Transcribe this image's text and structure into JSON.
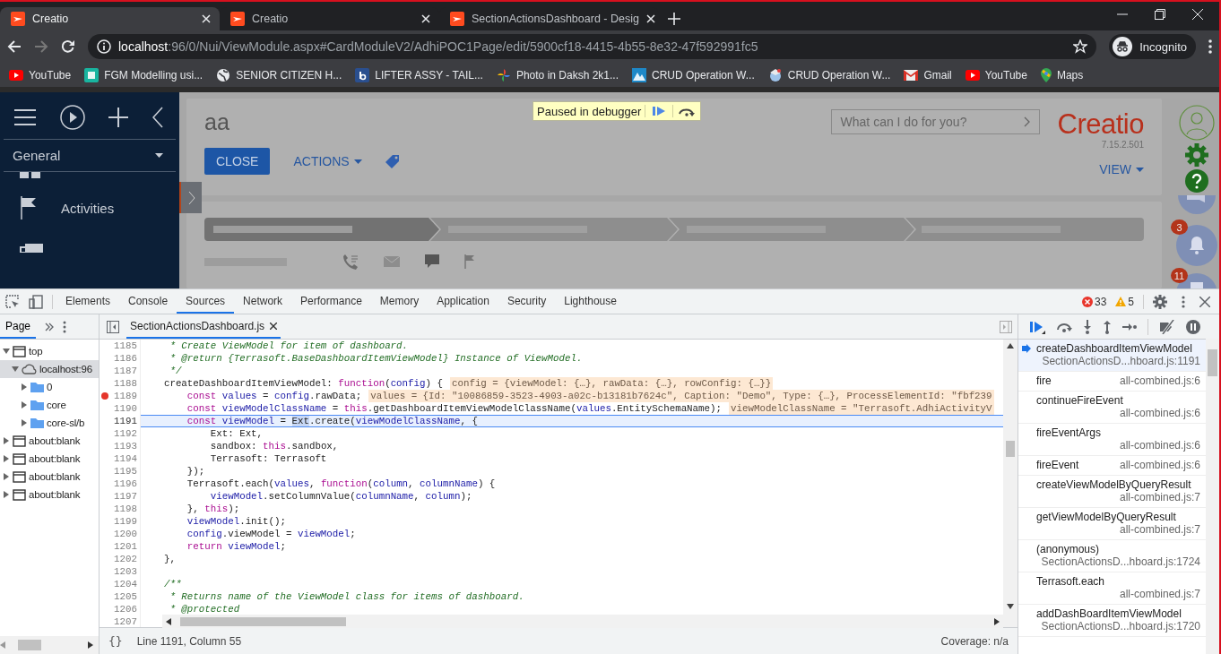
{
  "browser": {
    "tabs": [
      {
        "title": "Creatio",
        "selected": true
      },
      {
        "title": "Creatio",
        "selected": false
      },
      {
        "title": "SectionActionsDashboard - Desig",
        "selected": false
      }
    ],
    "address": {
      "host": "localhost",
      "path": ":96/0/Nui/ViewModule.aspx#CardModuleV2/AdhiPOC1Page/edit/5900cf18-4415-4b55-8e32-47f592991fc5"
    },
    "profile": "Incognito",
    "bookmarks": [
      {
        "kind": "youtube",
        "label": "YouTube"
      },
      {
        "kind": "tile",
        "label": "FGM Modelling usi..."
      },
      {
        "kind": "globe",
        "label": "SENIOR CITIZEN H..."
      },
      {
        "kind": "square",
        "label": "LIFTER ASSY - TAIL..."
      },
      {
        "kind": "pinwheel",
        "label": "Photo in Daksh 2k1..."
      },
      {
        "kind": "mountain",
        "label": "CRUD Operation W..."
      },
      {
        "kind": "app",
        "label": "CRUD Operation W..."
      },
      {
        "kind": "gmail",
        "label": "Gmail"
      },
      {
        "kind": "youtube",
        "label": "YouTube"
      },
      {
        "kind": "maps",
        "label": "Maps"
      }
    ]
  },
  "app": {
    "sidebar": {
      "section": "General",
      "items": [
        {
          "kind": "accounts"
        },
        {
          "kind": "activities",
          "label": "Activities"
        },
        {
          "kind": "feed"
        }
      ]
    },
    "record": {
      "title": "aa",
      "close": "CLOSE",
      "actions": "ACTIONS",
      "view": "VIEW"
    },
    "debugger_banner": "Paused in debugger",
    "search": {
      "placeholder": "What can I do for you?"
    },
    "logo": {
      "name": "Creatio",
      "version": "7.15.2.501"
    },
    "rail": [
      {
        "kind": "chat"
      },
      {
        "kind": "bell",
        "count": "3"
      },
      {
        "kind": "list",
        "count": "11"
      }
    ]
  },
  "devtools": {
    "tabs": [
      {
        "label": "Elements",
        "selected": false
      },
      {
        "label": "Console",
        "selected": false
      },
      {
        "label": "Sources",
        "selected": true
      },
      {
        "label": "Network",
        "selected": false
      },
      {
        "label": "Performance",
        "selected": false
      },
      {
        "label": "Memory",
        "selected": false
      },
      {
        "label": "Application",
        "selected": false
      },
      {
        "label": "Security",
        "selected": false
      },
      {
        "label": "Lighthouse",
        "selected": false
      }
    ],
    "errors": "33",
    "warnings": "5",
    "navigator": {
      "tabs": [
        {
          "label": "Page",
          "selected": true
        }
      ],
      "tree": [
        {
          "label": "top",
          "kind": "frame",
          "expanded": true,
          "selected": false,
          "children": [
            {
              "label": "localhost:96",
              "kind": "cloud",
              "expanded": true,
              "selected": true,
              "children": [
                {
                  "label": "0",
                  "kind": "folder",
                  "expanded": false,
                  "selected": false
                },
                {
                  "label": "core",
                  "kind": "folder",
                  "expanded": false,
                  "selected": false
                },
                {
                  "label": "core-sl/b",
                  "kind": "folder",
                  "expanded": false,
                  "selected": false
                }
              ]
            }
          ]
        },
        {
          "label": "about:blank",
          "kind": "frame",
          "expanded": false,
          "selected": false
        },
        {
          "label": "about:blank",
          "kind": "frame",
          "expanded": false,
          "selected": false
        },
        {
          "label": "about:blank",
          "kind": "frame",
          "expanded": false,
          "selected": false
        },
        {
          "label": "about:blank",
          "kind": "frame",
          "expanded": false,
          "selected": false
        }
      ]
    },
    "editor": {
      "file": "SectionActionsDashboard.js",
      "lines": [
        {
          "n": "1185",
          "breakpoint": false,
          "current": false,
          "tokens": [
            {
              "kind": "comment",
              "text": "     * Create ViewModel for item of dashboard."
            }
          ]
        },
        {
          "n": "1186",
          "breakpoint": false,
          "current": false,
          "tokens": [
            {
              "kind": "comment",
              "text": "     * @return {Terrasoft.BaseDashboardItemViewModel} Instance of ViewModel."
            }
          ]
        },
        {
          "n": "1187",
          "breakpoint": false,
          "current": false,
          "tokens": [
            {
              "kind": "comment",
              "text": "     */"
            }
          ]
        },
        {
          "n": "1188",
          "breakpoint": false,
          "current": false,
          "tokens": [
            {
              "kind": "plain",
              "text": "    createDashboardItemViewModel: "
            },
            {
              "kind": "keyword",
              "text": "function"
            },
            {
              "kind": "plain",
              "text": "("
            },
            {
              "kind": "name",
              "text": "config"
            },
            {
              "kind": "plain",
              "text": ") {"
            }
          ],
          "inline": "config = {viewModel: {…}, rawData: {…}, rowConfig: {…}}"
        },
        {
          "n": "1189",
          "breakpoint": true,
          "current": false,
          "tokens": [
            {
              "kind": "keyword",
              "text": "        const "
            },
            {
              "kind": "name",
              "text": "values"
            },
            {
              "kind": "plain",
              "text": " = "
            },
            {
              "kind": "name",
              "text": "config"
            },
            {
              "kind": "plain",
              "text": ".rawData;"
            }
          ],
          "inline": "values = {Id: \"10086859-3523-4903-a02c-b13181b7624c\", Caption: \"Demo\", Type: {…}, ProcessElementId: \"fbf239"
        },
        {
          "n": "1190",
          "breakpoint": false,
          "current": false,
          "tokens": [
            {
              "kind": "keyword",
              "text": "        const "
            },
            {
              "kind": "name",
              "text": "viewModelClassName"
            },
            {
              "kind": "plain",
              "text": " = "
            },
            {
              "kind": "keyword",
              "text": "this"
            },
            {
              "kind": "plain",
              "text": ".getDashboardItemViewModelClassName("
            },
            {
              "kind": "name",
              "text": "values"
            },
            {
              "kind": "plain",
              "text": ".EntitySchemaName);"
            }
          ],
          "inline": "viewModelClassName = \"Terrasoft.AdhiActivityV"
        },
        {
          "n": "1191",
          "breakpoint": false,
          "current": true,
          "tokens": [
            {
              "kind": "keyword",
              "text": "        const "
            },
            {
              "kind": "name",
              "text": "viewModel"
            },
            {
              "kind": "plain",
              "text": " = "
            },
            {
              "kind": "selection",
              "text": "Ext"
            },
            {
              "kind": "plain",
              "text": ".create("
            },
            {
              "kind": "name",
              "text": "viewModelClassName"
            },
            {
              "kind": "plain",
              "text": ", {"
            }
          ]
        },
        {
          "n": "1192",
          "breakpoint": false,
          "current": false,
          "tokens": [
            {
              "kind": "plain",
              "text": "            Ext: Ext,"
            }
          ]
        },
        {
          "n": "1193",
          "breakpoint": false,
          "current": false,
          "tokens": [
            {
              "kind": "plain",
              "text": "            sandbox: "
            },
            {
              "kind": "keyword",
              "text": "this"
            },
            {
              "kind": "plain",
              "text": ".sandbox,"
            }
          ]
        },
        {
          "n": "1194",
          "breakpoint": false,
          "current": false,
          "tokens": [
            {
              "kind": "plain",
              "text": "            Terrasoft: Terrasoft"
            }
          ]
        },
        {
          "n": "1195",
          "breakpoint": false,
          "current": false,
          "tokens": [
            {
              "kind": "plain",
              "text": "        });"
            }
          ]
        },
        {
          "n": "1196",
          "breakpoint": false,
          "current": false,
          "tokens": [
            {
              "kind": "plain",
              "text": "        Terrasoft.each("
            },
            {
              "kind": "name",
              "text": "values"
            },
            {
              "kind": "plain",
              "text": ", "
            },
            {
              "kind": "keyword",
              "text": "function"
            },
            {
              "kind": "plain",
              "text": "("
            },
            {
              "kind": "name",
              "text": "column"
            },
            {
              "kind": "plain",
              "text": ", "
            },
            {
              "kind": "name",
              "text": "columnName"
            },
            {
              "kind": "plain",
              "text": ") {"
            }
          ]
        },
        {
          "n": "1197",
          "breakpoint": false,
          "current": false,
          "tokens": [
            {
              "kind": "name",
              "text": "            viewModel"
            },
            {
              "kind": "plain",
              "text": ".setColumnValue("
            },
            {
              "kind": "name",
              "text": "columnName"
            },
            {
              "kind": "plain",
              "text": ", "
            },
            {
              "kind": "name",
              "text": "column"
            },
            {
              "kind": "plain",
              "text": ");"
            }
          ]
        },
        {
          "n": "1198",
          "breakpoint": false,
          "current": false,
          "tokens": [
            {
              "kind": "plain",
              "text": "        }, "
            },
            {
              "kind": "keyword",
              "text": "this"
            },
            {
              "kind": "plain",
              "text": ");"
            }
          ]
        },
        {
          "n": "1199",
          "breakpoint": false,
          "current": false,
          "tokens": [
            {
              "kind": "name",
              "text": "        viewModel"
            },
            {
              "kind": "plain",
              "text": ".init();"
            }
          ]
        },
        {
          "n": "1200",
          "breakpoint": false,
          "current": false,
          "tokens": [
            {
              "kind": "name",
              "text": "        config"
            },
            {
              "kind": "plain",
              "text": ".viewModel = "
            },
            {
              "kind": "name",
              "text": "viewModel"
            },
            {
              "kind": "plain",
              "text": ";"
            }
          ]
        },
        {
          "n": "1201",
          "breakpoint": false,
          "current": false,
          "tokens": [
            {
              "kind": "keyword",
              "text": "        return "
            },
            {
              "kind": "name",
              "text": "viewModel"
            },
            {
              "kind": "plain",
              "text": ";"
            }
          ]
        },
        {
          "n": "1202",
          "breakpoint": false,
          "current": false,
          "tokens": [
            {
              "kind": "plain",
              "text": "    },"
            }
          ]
        },
        {
          "n": "1203",
          "breakpoint": false,
          "current": false
        },
        {
          "n": "1204",
          "breakpoint": false,
          "current": false,
          "tokens": [
            {
              "kind": "comment",
              "text": "    /**"
            }
          ]
        },
        {
          "n": "1205",
          "breakpoint": false,
          "current": false,
          "tokens": [
            {
              "kind": "comment",
              "text": "     * Returns name of the ViewModel class for items of dashboard."
            }
          ]
        },
        {
          "n": "1206",
          "breakpoint": false,
          "current": false,
          "tokens": [
            {
              "kind": "comment",
              "text": "     * @protected"
            }
          ]
        },
        {
          "n": "1207",
          "breakpoint": false,
          "current": false
        }
      ]
    },
    "status": {
      "pretty_print": "{}",
      "position": "Line 1191, Column 55",
      "coverage": "Coverage: n/a"
    },
    "call_stack": [
      {
        "name": "createDashboardItemViewModel",
        "location": "SectionActionsD...hboard.js:1191",
        "kind": "stacked",
        "selected": true
      },
      {
        "name": "fire",
        "location": "all-combined.js:6",
        "kind": "inline",
        "selected": false
      },
      {
        "name": "continueFireEvent",
        "location": "all-combined.js:6",
        "kind": "stacked",
        "selected": false
      },
      {
        "name": "fireEventArgs",
        "location": "all-combined.js:6",
        "kind": "stacked",
        "selected": false
      },
      {
        "name": "fireEvent",
        "location": "all-combined.js:6",
        "kind": "inline",
        "selected": false
      },
      {
        "name": "createViewModelByQueryResult",
        "location": "all-combined.js:7",
        "kind": "stacked",
        "selected": false
      },
      {
        "name": "getViewModelByQueryResult",
        "location": "all-combined.js:7",
        "kind": "stacked",
        "selected": false
      },
      {
        "name": "(anonymous)",
        "location": "SectionActionsD...hboard.js:1724",
        "kind": "stacked",
        "selected": false
      },
      {
        "name": "Terrasoft.each",
        "location": "all-combined.js:7",
        "kind": "stacked",
        "selected": false
      },
      {
        "name": "addDashBoardItemViewModel",
        "location": "SectionActionsD...hboard.js:1720",
        "kind": "stacked",
        "selected": false
      }
    ]
  }
}
